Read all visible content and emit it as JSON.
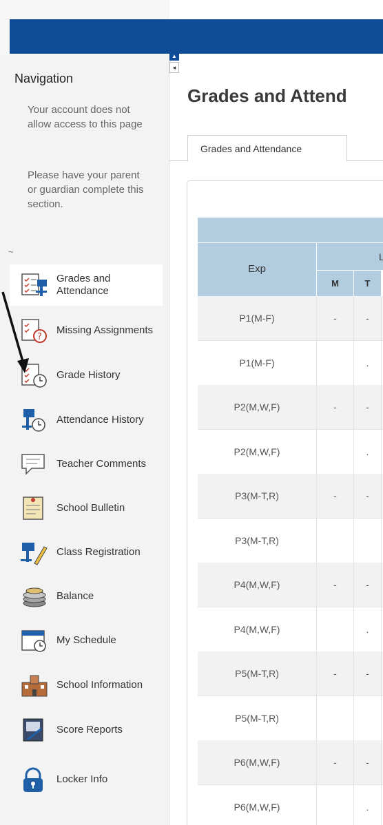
{
  "colors": {
    "topbar": "#0f4c96",
    "table_header": "#b3cde0",
    "row_alt": "#f2f2f2"
  },
  "sidebar": {
    "title": "Navigation",
    "message_1": "Your account does not allow access to this page",
    "message_2": "Please have your parent or guardian complete this section.",
    "tilde": "~",
    "items": [
      {
        "label": "Grades and Attendance",
        "icon": "gradebook-icon",
        "active": true
      },
      {
        "label": "Missing Assignments",
        "icon": "missing-assignments-icon",
        "active": false
      },
      {
        "label": "Grade History",
        "icon": "grade-history-icon",
        "active": false
      },
      {
        "label": "Attendance History",
        "icon": "attendance-history-icon",
        "active": false
      },
      {
        "label": "Teacher Comments",
        "icon": "speech-bubble-icon",
        "active": false
      },
      {
        "label": "School Bulletin",
        "icon": "bulletin-icon",
        "active": false
      },
      {
        "label": "Class Registration",
        "icon": "class-registration-icon",
        "active": false
      },
      {
        "label": "Balance",
        "icon": "coins-icon",
        "active": false
      },
      {
        "label": "My Schedule",
        "icon": "schedule-icon",
        "active": false
      },
      {
        "label": "School Information",
        "icon": "school-building-icon",
        "active": false
      },
      {
        "label": "Score Reports",
        "icon": "score-report-icon",
        "active": false
      },
      {
        "label": "Locker Info",
        "icon": "lock-icon",
        "active": false
      }
    ]
  },
  "main": {
    "title": "Grades and Attend",
    "tab_label": "Grades and Attendance",
    "table": {
      "col_exp": "Exp",
      "col_group_partial": "La",
      "col_m": "M",
      "col_t": "T",
      "rows": [
        {
          "exp": "P1(M-F)",
          "m": "-",
          "t": "-"
        },
        {
          "exp": "P1(M-F)",
          "m": "",
          "t": "."
        },
        {
          "exp": "P2(M,W,F)",
          "m": "-",
          "t": "-"
        },
        {
          "exp": "P2(M,W,F)",
          "m": "",
          "t": "."
        },
        {
          "exp": "P3(M-T,R)",
          "m": "-",
          "t": "-"
        },
        {
          "exp": "P3(M-T,R)",
          "m": "",
          "t": ""
        },
        {
          "exp": "P4(M,W,F)",
          "m": "-",
          "t": "-"
        },
        {
          "exp": "P4(M,W,F)",
          "m": "",
          "t": "."
        },
        {
          "exp": "P5(M-T,R)",
          "m": "-",
          "t": "-"
        },
        {
          "exp": "P5(M-T,R)",
          "m": "",
          "t": ""
        },
        {
          "exp": "P6(M,W,F)",
          "m": "-",
          "t": "-"
        },
        {
          "exp": "P6(M,W,F)",
          "m": "",
          "t": "."
        }
      ]
    }
  }
}
